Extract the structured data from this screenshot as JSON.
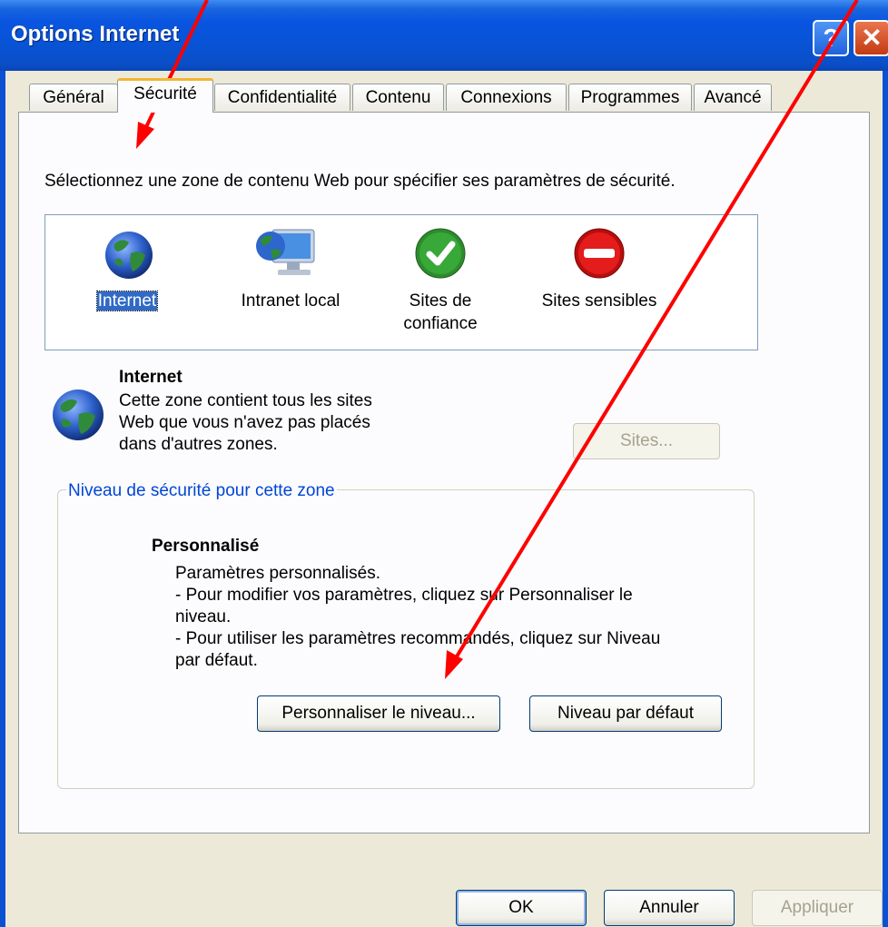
{
  "window": {
    "title": "Options Internet"
  },
  "tabs": [
    {
      "label": "Général"
    },
    {
      "label": "Sécurité"
    },
    {
      "label": "Confidentialité"
    },
    {
      "label": "Contenu"
    },
    {
      "label": "Connexions"
    },
    {
      "label": "Programmes"
    },
    {
      "label": "Avancé"
    }
  ],
  "security": {
    "instruction": "Sélectionnez une zone de contenu Web pour spécifier ses paramètres de sécurité.",
    "zones": [
      {
        "label": "Internet",
        "icon": "globe-icon",
        "selected": true
      },
      {
        "label": "Intranet local",
        "icon": "intranet-icon"
      },
      {
        "label_line1": "Sites de",
        "label_line2": "confiance",
        "icon": "checkmark-icon"
      },
      {
        "label": "Sites sensibles",
        "icon": "restricted-icon"
      }
    ],
    "zone_info": {
      "title": "Internet",
      "desc_line1": "Cette zone contient tous les sites",
      "desc_line2": "Web que vous n'avez pas placés",
      "desc_line3": "dans d'autres zones."
    },
    "sites_button": "Sites...",
    "level_group": {
      "label": "Niveau de sécurité pour cette zone",
      "level_title": "Personnalisé",
      "line1": "Paramètres personnalisés.",
      "line2": "- Pour modifier vos paramètres, cliquez sur Personnaliser le",
      "line3": "niveau.",
      "line4": "- Pour utiliser les paramètres recommandés, cliquez sur Niveau",
      "line5": "par défaut.",
      "custom_button": "Personnaliser le niveau...",
      "default_button": "Niveau par défaut"
    }
  },
  "footer": {
    "ok": "OK",
    "cancel": "Annuler",
    "apply": "Appliquer"
  },
  "colors": {
    "titlebar": "#0a55e0",
    "face": "#ece9d8",
    "annotation_arrow": "#ff0000"
  }
}
